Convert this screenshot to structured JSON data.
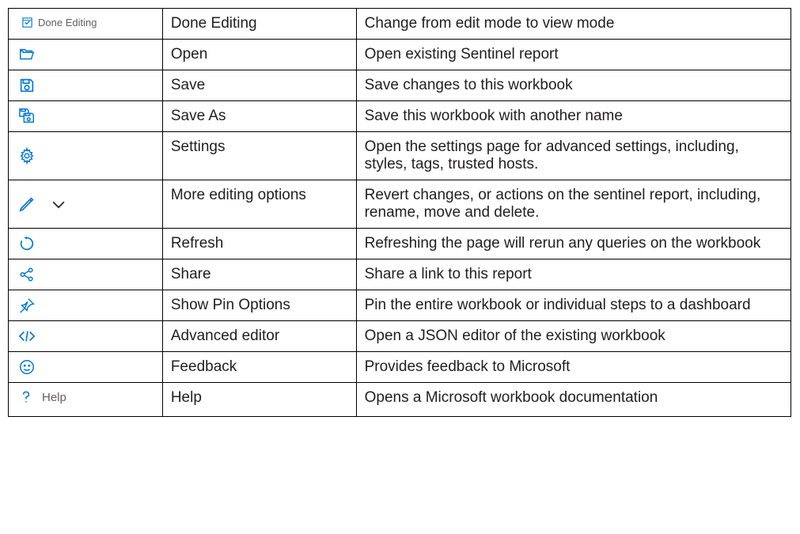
{
  "rows": [
    {
      "id": "done-editing",
      "icon_label": "Done Editing",
      "name": "Done Editing",
      "description": "Change from edit mode to view mode"
    },
    {
      "id": "open",
      "icon_label": "",
      "name": "Open",
      "description": "Open existing Sentinel report"
    },
    {
      "id": "save",
      "icon_label": "",
      "name": "Save",
      "description": "Save changes to this workbook"
    },
    {
      "id": "save-as",
      "icon_label": "",
      "name": "Save As",
      "description": "Save this workbook with another name"
    },
    {
      "id": "settings",
      "icon_label": "",
      "name": "Settings",
      "description": "Open the settings page for advanced settings, including, styles, tags, trusted hosts."
    },
    {
      "id": "more-edit",
      "icon_label": "",
      "name": "More editing options",
      "description": "Revert changes, or actions on the sentinel report, including, rename, move and delete."
    },
    {
      "id": "refresh",
      "icon_label": "",
      "name": "Refresh",
      "description": "Refreshing the page will rerun any queries on the workbook"
    },
    {
      "id": "share",
      "icon_label": "",
      "name": "Share",
      "description": "Share a link to this report"
    },
    {
      "id": "pin",
      "icon_label": "",
      "name": "Show Pin Options",
      "description": "Pin the entire workbook or individual steps to a dashboard"
    },
    {
      "id": "adv-editor",
      "icon_label": "",
      "name": "Advanced editor",
      "description": "Open a JSON editor of the existing workbook"
    },
    {
      "id": "feedback",
      "icon_label": "",
      "name": "Feedback",
      "description": "Provides feedback to Microsoft"
    },
    {
      "id": "help",
      "icon_label": "Help",
      "name": "Help",
      "description": "Opens a Microsoft workbook documentation"
    }
  ]
}
